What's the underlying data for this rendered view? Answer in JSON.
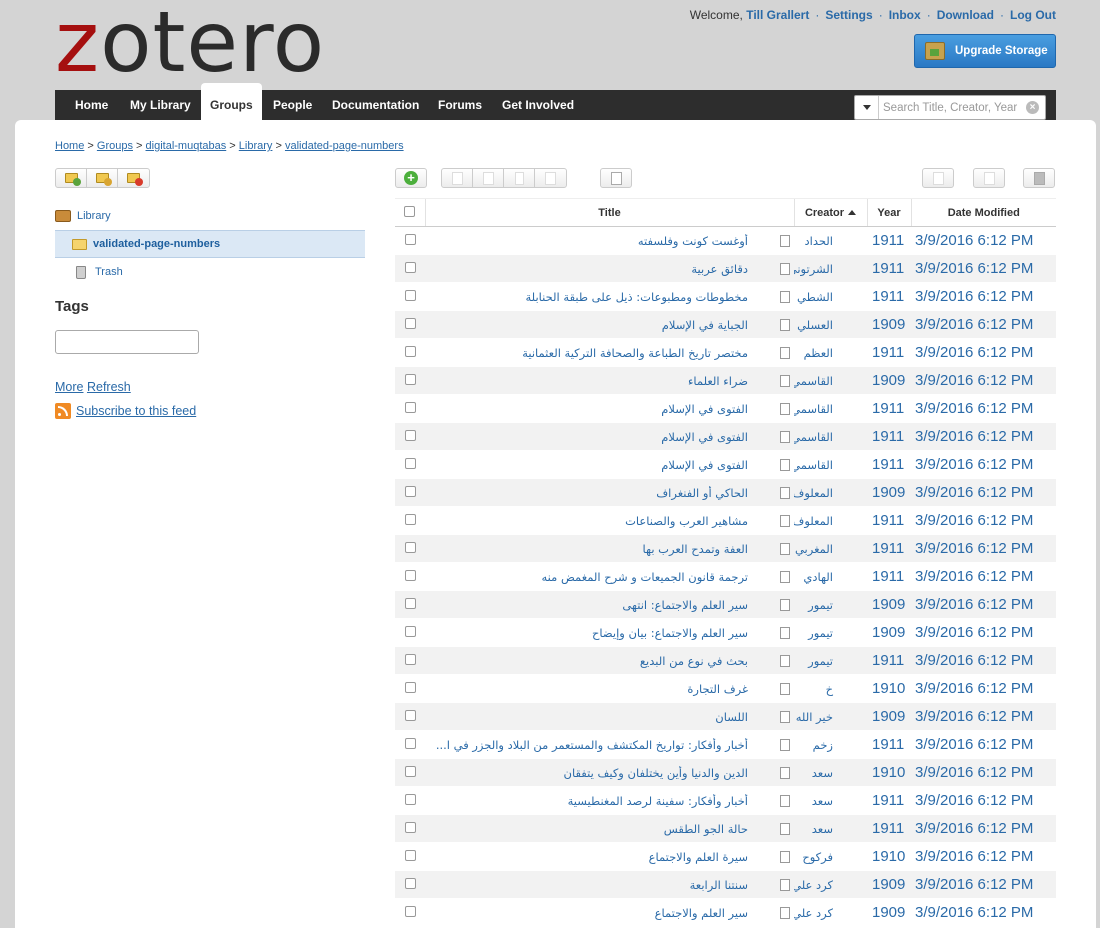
{
  "logo": {
    "z": "z",
    "rest": "otero"
  },
  "userbar": {
    "welcome": "Welcome,",
    "user": "Till Grallert",
    "links": [
      "Settings",
      "Inbox",
      "Download",
      "Log Out"
    ]
  },
  "upgrade_label": "Upgrade Storage",
  "nav": {
    "tabs": [
      "Home",
      "My Library",
      "Groups",
      "People",
      "Documentation",
      "Forums",
      "Get Involved"
    ],
    "active": "Groups"
  },
  "search": {
    "placeholder": "Search Title, Creator, Year"
  },
  "breadcrumb": [
    "Home",
    "Groups",
    "digital-muqtabas",
    "Library",
    "validated-page-numbers"
  ],
  "collections": {
    "library": "Library",
    "selected": "validated-page-numbers",
    "trash": "Trash"
  },
  "tags": {
    "heading": "Tags"
  },
  "links": {
    "more": "More",
    "refresh": "Refresh",
    "subscribe": "Subscribe to this feed"
  },
  "table": {
    "headers": {
      "title": "Title",
      "creator": "Creator",
      "year": "Year",
      "date": "Date Modified"
    },
    "rows": [
      {
        "title": "أوغست كونت وفلسفته",
        "creator": "الحداد",
        "year": "1911",
        "date": "3/9/2016 6:12 PM"
      },
      {
        "title": "دقائق عربية",
        "creator": "الشرتوني",
        "year": "1911",
        "date": "3/9/2016 6:12 PM"
      },
      {
        "title": "مخطوطات ومطبوعات: ذيل على طبقة الحنابلة",
        "creator": "الشطي",
        "year": "1911",
        "date": "3/9/2016 6:12 PM"
      },
      {
        "title": "الجباية في الإسلام",
        "creator": "العسلي",
        "year": "1909",
        "date": "3/9/2016 6:12 PM"
      },
      {
        "title": "مختصر تاريخ الطباعة والصحافة التركية العثمانية",
        "creator": "العظم",
        "year": "1911",
        "date": "3/9/2016 6:12 PM"
      },
      {
        "title": "ضراء العلماء",
        "creator": "القاسمي",
        "year": "1909",
        "date": "3/9/2016 6:12 PM"
      },
      {
        "title": "الفتوى في الإسلام",
        "creator": "القاسمي",
        "year": "1911",
        "date": "3/9/2016 6:12 PM"
      },
      {
        "title": "الفتوى في الإسلام",
        "creator": "القاسمي",
        "year": "1911",
        "date": "3/9/2016 6:12 PM"
      },
      {
        "title": "الفتوى في الإسلام",
        "creator": "القاسمي",
        "year": "1911",
        "date": "3/9/2016 6:12 PM"
      },
      {
        "title": "الحاكي أو الفنغراف",
        "creator": "المعلوف",
        "year": "1909",
        "date": "3/9/2016 6:12 PM"
      },
      {
        "title": "مشاهير العرب والصناعات",
        "creator": "المعلوف",
        "year": "1911",
        "date": "3/9/2016 6:12 PM"
      },
      {
        "title": "العفة وتمدح العرب بها",
        "creator": "المغربي",
        "year": "1911",
        "date": "3/9/2016 6:12 PM"
      },
      {
        "title": "ترجمة قانون الجميعات و شرح المغمض منه",
        "creator": "الهادي",
        "year": "1911",
        "date": "3/9/2016 6:12 PM"
      },
      {
        "title": "سير العلم والاجتماع: انتهى",
        "creator": "تيمور",
        "year": "1909",
        "date": "3/9/2016 6:12 PM"
      },
      {
        "title": "سير العلم والاجتماع: بيان وإيضاح",
        "creator": "تيمور",
        "year": "1909",
        "date": "3/9/2016 6:12 PM"
      },
      {
        "title": "بحث في نوع من البديع",
        "creator": "تيمور",
        "year": "1911",
        "date": "3/9/2016 6:12 PM"
      },
      {
        "title": "غرف التجارة",
        "creator": "خ",
        "year": "1910",
        "date": "3/9/2016 6:12 PM"
      },
      {
        "title": "اللسان",
        "creator": "خير الله",
        "year": "1909",
        "date": "3/9/2016 6:12 PM"
      },
      {
        "title": "أخبار وأفكار: تواريخ المكتشف والمستعمر من البلاد والجزر في ا...",
        "creator": "زخم",
        "year": "1911",
        "date": "3/9/2016 6:12 PM"
      },
      {
        "title": "الدين والدنيا وأين يختلفان وكيف يتفقان",
        "creator": "سعد",
        "year": "1910",
        "date": "3/9/2016 6:12 PM"
      },
      {
        "title": "أخبار وأفكار: سفينة لرصد المغنطيسية",
        "creator": "سعد",
        "year": "1911",
        "date": "3/9/2016 6:12 PM"
      },
      {
        "title": "حالة الجو الطقس",
        "creator": "سعد",
        "year": "1911",
        "date": "3/9/2016 6:12 PM"
      },
      {
        "title": "سيرة العلم والاجتماع",
        "creator": "فركوح",
        "year": "1910",
        "date": "3/9/2016 6:12 PM"
      },
      {
        "title": "سنتنا الرابعة",
        "creator": "كرد علي",
        "year": "1909",
        "date": "3/9/2016 6:12 PM"
      },
      {
        "title": "سير العلم والاجتماع",
        "creator": "كرد علي",
        "year": "1909",
        "date": "3/9/2016 6:12 PM"
      }
    ]
  }
}
